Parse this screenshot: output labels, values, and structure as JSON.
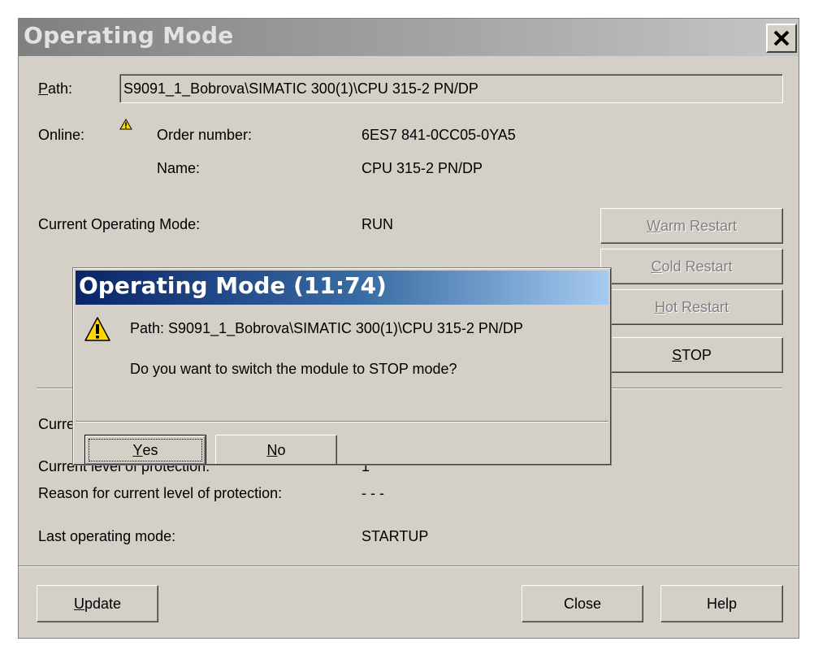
{
  "window": {
    "title": "Operating Mode",
    "close_glyph": "✕"
  },
  "path": {
    "label_accel": "P",
    "label_rest": "ath:",
    "value": "S9091_1_Bobrova\\SIMATIC 300(1)\\CPU 315-2 PN/DP"
  },
  "online": {
    "label": "Online:",
    "warning_icon": "warning-icon",
    "order_number_label": "Order number:",
    "order_number_value": "6ES7 841-0CC05-0YA5",
    "name_label": "Name:",
    "name_value": "CPU 315-2 PN/DP"
  },
  "mode": {
    "current_label": "Current Operating Mode:",
    "current_value": "RUN",
    "current_partial_label": "Curre",
    "protection_label": "Current level of protection:",
    "protection_value": "1",
    "reason_label": "Reason for current level of protection:",
    "reason_value": "- - -",
    "last_label": "Last operating mode:",
    "last_value": "STARTUP"
  },
  "buttons": {
    "warm_accel": "W",
    "warm_rest": "arm Restart",
    "cold_accel": "C",
    "cold_rest": "old Restart",
    "hot_accel": "H",
    "hot_rest": "ot Restart",
    "stop_accel": "S",
    "stop_rest": "TOP",
    "update_accel": "U",
    "update_rest": "pdate",
    "close": "Close",
    "help": "Help"
  },
  "confirm": {
    "title": "Operating Mode (11:74)",
    "path_text": "Path: S9091_1_Bobrova\\SIMATIC 300(1)\\CPU 315-2 PN/DP",
    "question": "Do you want to switch the module to STOP mode?",
    "yes_accel": "Y",
    "yes_rest": "es",
    "no_accel": "N",
    "no_rest": "o"
  },
  "colors": {
    "dialog_bg": "#d4d0c8",
    "inactive_title": "#808080",
    "active_title_start": "#0a246a",
    "active_title_end": "#a6caf0",
    "warning_yellow": "#ffd800"
  }
}
